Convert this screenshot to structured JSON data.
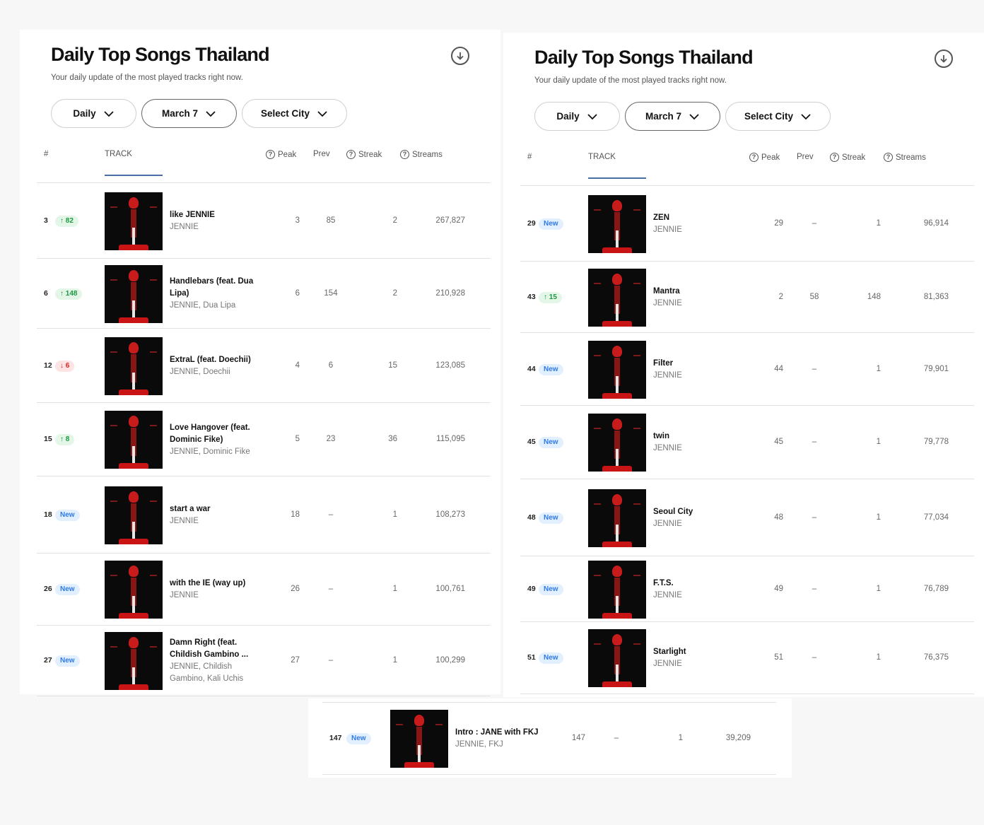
{
  "title": "Daily Top Songs Thailand",
  "subtitle": "Your daily update of the most played tracks right now.",
  "filters": {
    "period": "Daily",
    "date": "March 7",
    "city": "Select City"
  },
  "columns": {
    "rank": "#",
    "track": "TRACK",
    "peak": "Peak",
    "prev": "Prev",
    "streak": "Streak",
    "streams": "Streams"
  },
  "left_rows": [
    {
      "rank": "3",
      "badge": "↑ 82",
      "badge_type": "up",
      "name": "like JENNIE",
      "artist": "JENNIE",
      "peak": "3",
      "prev": "85",
      "streak": "2",
      "streams": "267,827"
    },
    {
      "rank": "6",
      "badge": "↑ 148",
      "badge_type": "up",
      "name": "Handlebars (feat. Dua Lipa)",
      "artist": "JENNIE, Dua Lipa",
      "peak": "6",
      "prev": "154",
      "streak": "2",
      "streams": "210,928"
    },
    {
      "rank": "12",
      "badge": "↓ 6",
      "badge_type": "down",
      "name": "ExtraL (feat. Doechii)",
      "artist": "JENNIE, Doechii",
      "peak": "4",
      "prev": "6",
      "streak": "15",
      "streams": "123,085"
    },
    {
      "rank": "15",
      "badge": "↑ 8",
      "badge_type": "up",
      "name": "Love Hangover (feat. Dominic Fike)",
      "artist": "JENNIE, Dominic Fike",
      "peak": "5",
      "prev": "23",
      "streak": "36",
      "streams": "115,095"
    },
    {
      "rank": "18",
      "badge": "New",
      "badge_type": "new",
      "name": "start a war",
      "artist": "JENNIE",
      "peak": "18",
      "prev": "–",
      "streak": "1",
      "streams": "108,273"
    },
    {
      "rank": "26",
      "badge": "New",
      "badge_type": "new",
      "name": "with the IE (way up)",
      "artist": "JENNIE",
      "peak": "26",
      "prev": "–",
      "streak": "1",
      "streams": "100,761"
    },
    {
      "rank": "27",
      "badge": "New",
      "badge_type": "new",
      "name": "Damn Right (feat. Childish Gambino ...",
      "artist": "JENNIE, Childish Gambino, Kali Uchis",
      "peak": "27",
      "prev": "–",
      "streak": "1",
      "streams": "100,299"
    }
  ],
  "right_rows": [
    {
      "rank": "29",
      "badge": "New",
      "badge_type": "new",
      "name": "ZEN",
      "artist": "JENNIE",
      "peak": "29",
      "prev": "–",
      "streak": "1",
      "streams": "96,914"
    },
    {
      "rank": "43",
      "badge": "↑ 15",
      "badge_type": "up",
      "name": "Mantra",
      "artist": "JENNIE",
      "peak": "2",
      "prev": "58",
      "streak": "148",
      "streams": "81,363"
    },
    {
      "rank": "44",
      "badge": "New",
      "badge_type": "new",
      "name": "Filter",
      "artist": "JENNIE",
      "peak": "44",
      "prev": "–",
      "streak": "1",
      "streams": "79,901"
    },
    {
      "rank": "45",
      "badge": "New",
      "badge_type": "new",
      "name": "twin",
      "artist": "JENNIE",
      "peak": "45",
      "prev": "–",
      "streak": "1",
      "streams": "79,778"
    },
    {
      "rank": "48",
      "badge": "New",
      "badge_type": "new",
      "name": "Seoul City",
      "artist": "JENNIE",
      "peak": "48",
      "prev": "–",
      "streak": "1",
      "streams": "77,034"
    },
    {
      "rank": "49",
      "badge": "New",
      "badge_type": "new",
      "name": "F.T.S.",
      "artist": "JENNIE",
      "peak": "49",
      "prev": "–",
      "streak": "1",
      "streams": "76,789"
    },
    {
      "rank": "51",
      "badge": "New",
      "badge_type": "new",
      "name": "Starlight",
      "artist": "JENNIE",
      "peak": "51",
      "prev": "–",
      "streak": "1",
      "streams": "76,375"
    }
  ],
  "bottom_rows": [
    {
      "rank": "147",
      "badge": "New",
      "badge_type": "new",
      "name": "Intro : JANE with FKJ",
      "artist": "JENNIE, FKJ",
      "peak": "147",
      "prev": "–",
      "streak": "1",
      "streams": "39,209"
    }
  ],
  "colors": {
    "up": "#1d9a3e",
    "down": "#d62828",
    "new": "#2f7ae5",
    "accent": "#4a6fa5"
  },
  "icons": {
    "download": "download-circle-icon",
    "chevron": "chevron-down-icon",
    "help": "question-circle-icon"
  }
}
